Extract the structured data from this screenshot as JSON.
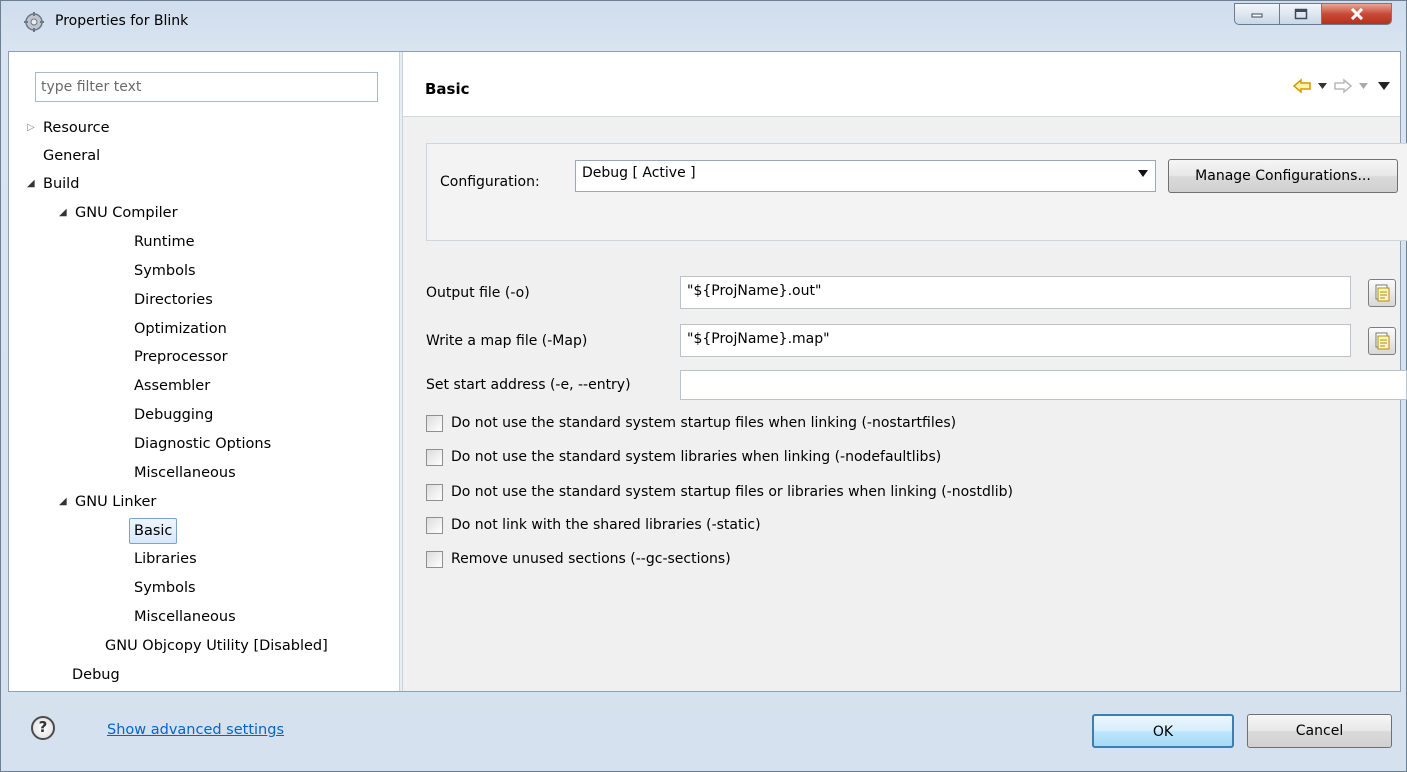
{
  "window": {
    "title": "Properties for Blink",
    "minimize_icon": "minimize-icon",
    "maximize_icon": "maximize-icon",
    "close_icon": "close-icon"
  },
  "filter": {
    "placeholder": "type filter text",
    "value": ""
  },
  "tree": {
    "resource": "Resource",
    "general": "General",
    "build": "Build",
    "gnu_compiler": "GNU Compiler",
    "runtime": "Runtime",
    "symbols": "Symbols",
    "directories": "Directories",
    "optimization": "Optimization",
    "preprocessor": "Preprocessor",
    "assembler": "Assembler",
    "debugging": "Debugging",
    "diagnostic_options": "Diagnostic Options",
    "miscellaneous": "Miscellaneous",
    "gnu_linker": "GNU Linker",
    "basic": "Basic",
    "libraries": "Libraries",
    "linker_symbols": "Symbols",
    "linker_misc": "Miscellaneous",
    "objcopy": "GNU Objcopy Utility  [Disabled]",
    "debug": "Debug",
    "selected": "Basic"
  },
  "page": {
    "title": "Basic",
    "configuration_label": "Configuration:",
    "configuration_value": "Debug  [ Active ]",
    "manage_button": "Manage Configurations...",
    "output_label": "Output file (-o)",
    "output_value": "\"${ProjName}.out\"",
    "map_label": "Write a map file (-Map)",
    "map_value": "\"${ProjName}.map\"",
    "start_label": "Set start address (-e, --entry)",
    "start_value": "",
    "options": [
      {
        "label": "Do not use the standard system startup files when linking (-nostartfiles)",
        "checked": false
      },
      {
        "label": "Do not use the standard system libraries when linking (-nodefaultlibs)",
        "checked": false
      },
      {
        "label": "Do not use the standard system startup files or libraries when linking (-nostdlib)",
        "checked": false
      },
      {
        "label": "Do not link with the shared libraries (-static)",
        "checked": false
      },
      {
        "label": "Remove unused sections (--gc-sections)",
        "checked": false
      }
    ]
  },
  "footer": {
    "help_icon": "help-icon",
    "advanced_link": "Show advanced settings",
    "ok": "OK",
    "cancel": "Cancel"
  },
  "colors": {
    "link": "#0066cc",
    "selection_border": "#7da2ce",
    "nav_arrow": "#e8a800"
  }
}
